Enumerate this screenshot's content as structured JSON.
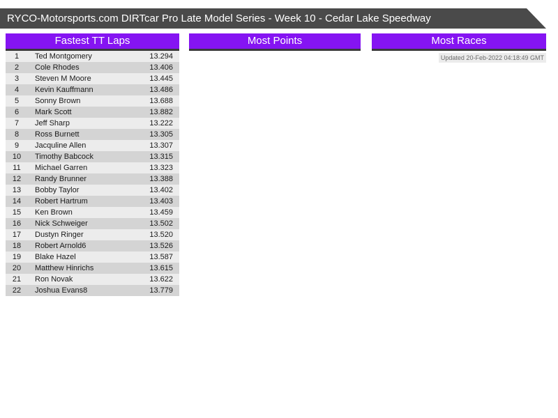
{
  "header": {
    "title": "RYCO-Motorsports.com DIRTcar Pro Late Model Series - Week 10 - Cedar Lake Speedway"
  },
  "sections": {
    "fastest_tt": {
      "title": "Fastest TT Laps"
    },
    "most_points": {
      "title": "Most Points"
    },
    "most_races": {
      "title": "Most Races"
    }
  },
  "updated_label": "Updated 20-Feb-2022 04:18:49 GMT",
  "colors": {
    "banner_gray": "#4a4a4a",
    "accent_purple": "#8514f2",
    "header_underline": "#3a3a3a",
    "row_light": "#ececec",
    "row_dark": "#d4d4d4"
  },
  "fastest_tt_laps": {
    "columns": [
      "rank",
      "driver",
      "time"
    ],
    "rows": [
      {
        "rank": "1",
        "driver": "Ted Montgomery",
        "time": "13.294"
      },
      {
        "rank": "2",
        "driver": "Cole Rhodes",
        "time": "13.406"
      },
      {
        "rank": "3",
        "driver": "Steven M Moore",
        "time": "13.445"
      },
      {
        "rank": "4",
        "driver": "Kevin Kauffmann",
        "time": "13.486"
      },
      {
        "rank": "5",
        "driver": "Sonny Brown",
        "time": "13.688"
      },
      {
        "rank": "6",
        "driver": "Mark Scott",
        "time": "13.882"
      },
      {
        "rank": "7",
        "driver": "Jeff Sharp",
        "time": "13.222"
      },
      {
        "rank": "8",
        "driver": "Ross Burnett",
        "time": "13.305"
      },
      {
        "rank": "9",
        "driver": "Jacquline Allen",
        "time": "13.307"
      },
      {
        "rank": "10",
        "driver": "Timothy Babcock",
        "time": "13.315"
      },
      {
        "rank": "11",
        "driver": "Michael Garren",
        "time": "13.323"
      },
      {
        "rank": "12",
        "driver": "Randy Brunner",
        "time": "13.388"
      },
      {
        "rank": "13",
        "driver": "Bobby Taylor",
        "time": "13.402"
      },
      {
        "rank": "14",
        "driver": "Robert Hartrum",
        "time": "13.403"
      },
      {
        "rank": "15",
        "driver": "Ken Brown",
        "time": "13.459"
      },
      {
        "rank": "16",
        "driver": "Nick Schweiger",
        "time": "13.502"
      },
      {
        "rank": "17",
        "driver": "Dustyn Ringer",
        "time": "13.520"
      },
      {
        "rank": "18",
        "driver": "Robert Arnold6",
        "time": "13.526"
      },
      {
        "rank": "19",
        "driver": "Blake Hazel",
        "time": "13.587"
      },
      {
        "rank": "20",
        "driver": "Matthew Hinrichs",
        "time": "13.615"
      },
      {
        "rank": "21",
        "driver": "Ron Novak",
        "time": "13.622"
      },
      {
        "rank": "22",
        "driver": "Joshua Evans8",
        "time": "13.779"
      }
    ]
  }
}
